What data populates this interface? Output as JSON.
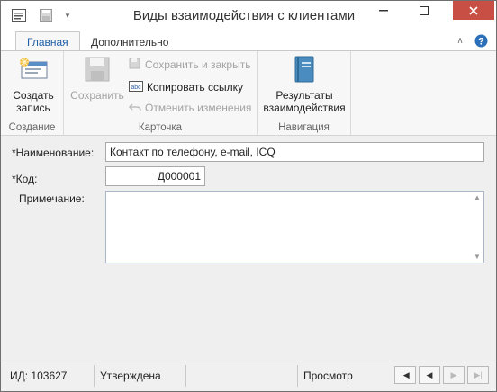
{
  "window": {
    "title": "Виды взаимодействия с клиентами"
  },
  "tabs": [
    {
      "label": "Главная"
    },
    {
      "label": "Дополнительно"
    }
  ],
  "ribbon": {
    "create": {
      "button": "Создать запись",
      "group": "Создание"
    },
    "card": {
      "save": "Сохранить",
      "save_close": "Сохранить и закрыть",
      "copy_link": "Копировать ссылку",
      "cancel_changes": "Отменить изменения",
      "group": "Карточка"
    },
    "navigation": {
      "button": "Результаты взаимодействия",
      "group": "Навигация"
    }
  },
  "form": {
    "name_label": "*Наименование:",
    "name_value": "Контакт по телефону, e-mail, ICQ",
    "code_label": "*Код:",
    "code_value": "Д000001",
    "note_label": "Примечание:",
    "note_value": ""
  },
  "status": {
    "id": "ИД: 103627",
    "state": "Утверждена",
    "mode": "Просмотр"
  },
  "colors": {
    "accent": "#1f5fa8",
    "close": "#c74f44",
    "help": "#2b6fb8"
  }
}
